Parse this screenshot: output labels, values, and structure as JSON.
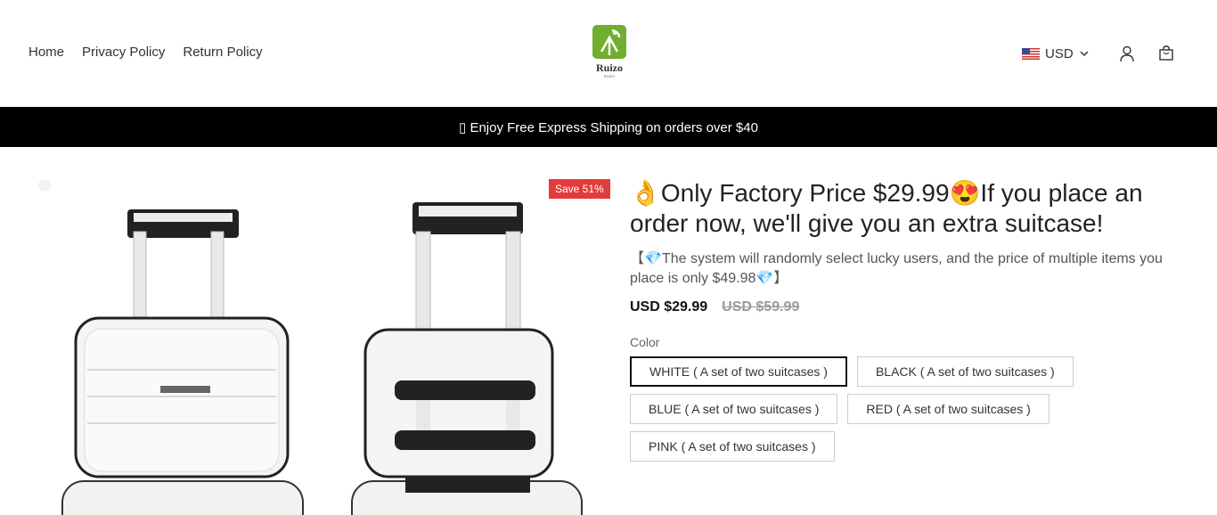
{
  "nav": {
    "items": [
      "Home",
      "Privacy Policy",
      "Return Policy"
    ]
  },
  "logo": {
    "name": "Ruizo",
    "sub": "RUIZO",
    "color": "#6fae2e"
  },
  "header": {
    "currency": "USD",
    "icons": [
      "us-flag-icon",
      "chevron-down-icon",
      "account-icon",
      "cart-icon"
    ]
  },
  "announcement": {
    "text": "▯ Enjoy Free Express Shipping on orders over $40"
  },
  "gallery": {
    "badge": "Save 51%",
    "badge_color": "#e33b3b"
  },
  "product": {
    "title": "👌Only Factory Price $29.99😍If you place an order now, we'll give you an extra suitcase!",
    "promo": "【💎The system will randomly select lucky users, and the price of multiple items you place is only $49.98💎】",
    "price": "USD $29.99",
    "compare_price": "USD $59.99",
    "color_label": "Color",
    "color_options": [
      {
        "label": "WHITE ( A set of two suitcases )",
        "selected": true
      },
      {
        "label": "BLACK ( A set of two suitcases )",
        "selected": false
      },
      {
        "label": "BLUE ( A set of two suitcases )",
        "selected": false
      },
      {
        "label": "RED ( A set of two suitcases )",
        "selected": false
      },
      {
        "label": "PINK ( A set of two suitcases )",
        "selected": false
      }
    ]
  }
}
